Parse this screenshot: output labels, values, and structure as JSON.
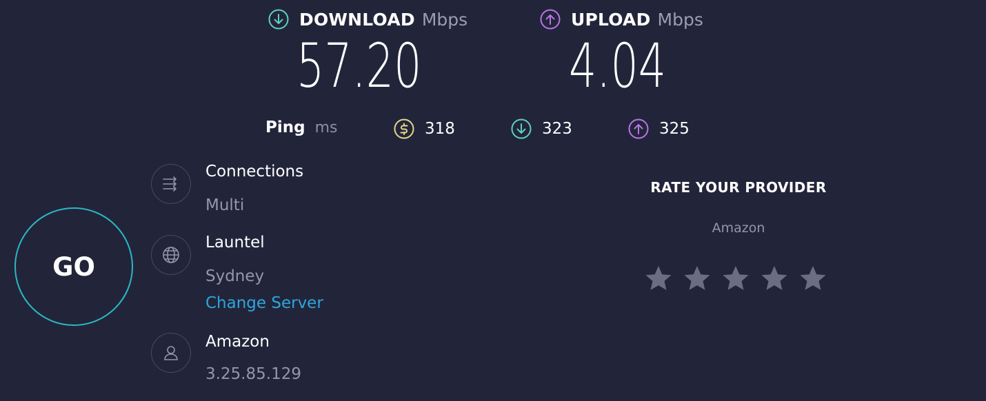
{
  "download": {
    "label": "DOWNLOAD",
    "unit": "Mbps",
    "value": "57.20",
    "icon": "arrow-down-circle-icon",
    "color": "#5ed1c0"
  },
  "upload": {
    "label": "UPLOAD",
    "unit": "Mbps",
    "value": "4.04",
    "icon": "arrow-up-circle-icon",
    "color": "#b974e8"
  },
  "ping": {
    "label": "Ping",
    "unit": "ms",
    "idle": {
      "value": "318",
      "icon": "ping-idle-icon",
      "color": "#e6d88a"
    },
    "download": {
      "value": "323",
      "icon": "arrow-down-circle-icon",
      "color": "#5ed1c0"
    },
    "upload": {
      "value": "325",
      "icon": "arrow-up-circle-icon",
      "color": "#b974e8"
    }
  },
  "go_button": {
    "label": "GO",
    "color": "#2bb8c4"
  },
  "connections": {
    "title": "Connections",
    "value": "Multi",
    "icon": "connections-icon"
  },
  "server": {
    "name": "Launtel",
    "location": "Sydney",
    "change_label": "Change Server",
    "icon": "globe-icon",
    "link_color": "#2fa5dd"
  },
  "provider": {
    "name": "Amazon",
    "ip": "3.25.85.129",
    "icon": "user-icon"
  },
  "rating": {
    "title": "RATE YOUR PROVIDER",
    "provider": "Amazon",
    "stars": 5,
    "selected": 0,
    "star_color": "#6b6e82"
  }
}
